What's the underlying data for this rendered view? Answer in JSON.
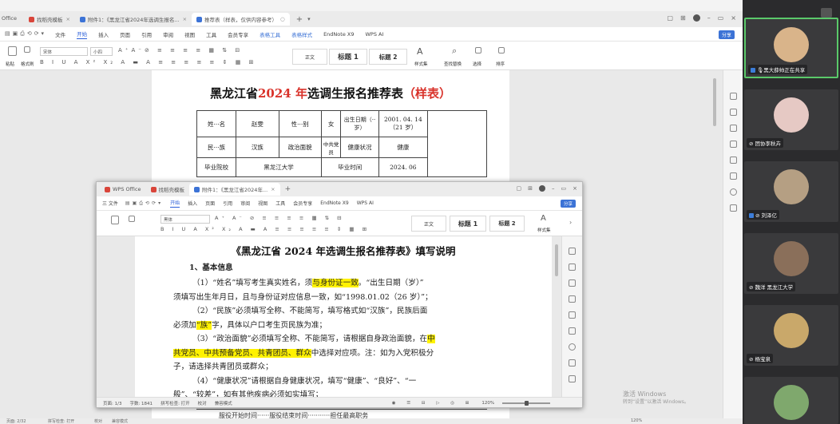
{
  "app": {
    "top_label": "Office"
  },
  "tabs": [
    {
      "label": "找稻壳模板",
      "color": "#d9453a"
    },
    {
      "label": "附件1：《黑龙江省2024年选调生报名...",
      "color": "#3c73d6"
    },
    {
      "label": "推荐表（样表，仅供内容参考）",
      "color": "#3c73d6"
    }
  ],
  "menu": [
    "文件",
    "开始",
    "插入",
    "页面",
    "引用",
    "审阅",
    "视图",
    "工具",
    "会员专享",
    "表格工具",
    "表格样式",
    "EndNote X9",
    "WPS AI"
  ],
  "menu_active": "开始",
  "share_label": "分享",
  "ribbon": {
    "font_name": "宋体",
    "font_size": "小四",
    "style_body": "正文",
    "style_h1": "标题 1",
    "style_h2": "标题 2",
    "styles_label": "样式集",
    "find_replace": "查找替换",
    "select": "选择",
    "sort": "排序",
    "paste": "粘贴",
    "format_painter": "格式刷"
  },
  "doc": {
    "title_pre": "黑龙江省",
    "title_year": "2024 年",
    "title_mid": "选调生报名推荐表",
    "title_sample": "（样表）",
    "table": [
      [
        "姓···名",
        "赵雯",
        "性···别",
        "女",
        "出生日期（··岁）",
        "2001. 04. 14（21 岁）"
      ],
      [
        "民···族",
        "汉族",
        "政治面貌",
        "中共党员",
        "健康状况",
        "健康"
      ],
      [
        "毕业院校",
        "黑龙江大学",
        "毕业时间",
        "2024. 06"
      ]
    ],
    "bottom_row": "服役开始时间······服役结束时间···········担任最高职务"
  },
  "win2": {
    "tabs": [
      {
        "label": "WPS Office",
        "color": "#d9453a"
      },
      {
        "label": "找稻壳模板",
        "color": "#d9453a"
      },
      {
        "label": "附件1：《黑龙江省2024年...",
        "color": "#3c73d6"
      }
    ],
    "menu": [
      "三 文件",
      "开始",
      "插入",
      "页面",
      "引用",
      "审阅",
      "视图",
      "工具",
      "会员专享",
      "EndNote X9",
      "WPS AI"
    ],
    "menu_active": "开始",
    "share_label": "分享",
    "font_name": "黑体",
    "style_body": "正文",
    "style_h1": "标题 1",
    "style_h2": "标题 2",
    "styles_label": "样式集",
    "title": "《黑龙江省 2024 年选调生报名推荐表》填写说明",
    "section1": "1、基本信息",
    "p1a": "（1）“姓名”填写考生真实姓名，须",
    "p1hl": "与身份证一致",
    "p1b": "。“出生日期（岁）”",
    "p1c": "须填写出生年月日，且与身份证对应信息一致，如“1998.01.02（26 岁）”；",
    "p2a": "（2）“民族”必须填写全称、不能简写，填写格式如“汉族”，民族后面",
    "p2b": "必须加",
    "p2hl": "“族”",
    "p2c": "字，具体以户口考生页民族为准；",
    "p3a": "（3）“政治面貌”必须填写全称、不能简写，请根据自身政治面貌，在",
    "p3hl1": "中",
    "p3hl2": "共党员、中共预备党员、共青团员、群众",
    "p3b": "中选择对应项。注：如为入党积极分",
    "p3c": "子，请选择共青团员或群众；",
    "p4a": "（4）“健康状况”请根据自身健康状况，填写“健康”、“良好”、“一",
    "p4b": "般”、“较差”，如有其他疾病必须如实填写；",
    "status_page": "页面: 1/3",
    "status_words": "字数: 1841",
    "status_spell": "拼写检查: 打开",
    "status_proof": "校对",
    "status_compat": "兼容模式",
    "zoom": "120%"
  },
  "main_status": {
    "page": "页面: 2/32",
    "spell": "拼写检查: 打开",
    "proof": "校对",
    "compat": "兼容模式",
    "zoom": "120%"
  },
  "watermark": {
    "line1": "激活 Windows",
    "line2": "转到“设置”以激活 Windows。"
  },
  "participants": [
    {
      "name": "黑大薛帅正在共享",
      "color": "#d9b48a",
      "active": true
    },
    {
      "name": "团协李秋卉",
      "color": "#e6c9c4",
      "active": false
    },
    {
      "name": "刘泽亿",
      "color": "#b59f83",
      "active": false
    },
    {
      "name": "魏洋 黑龙江大学",
      "color": "#8a6f5a",
      "active": false
    },
    {
      "name": "杨宝泉",
      "color": "#c9a86a",
      "active": false
    },
    {
      "name": "",
      "color": "#7fa86d",
      "active": false
    }
  ]
}
